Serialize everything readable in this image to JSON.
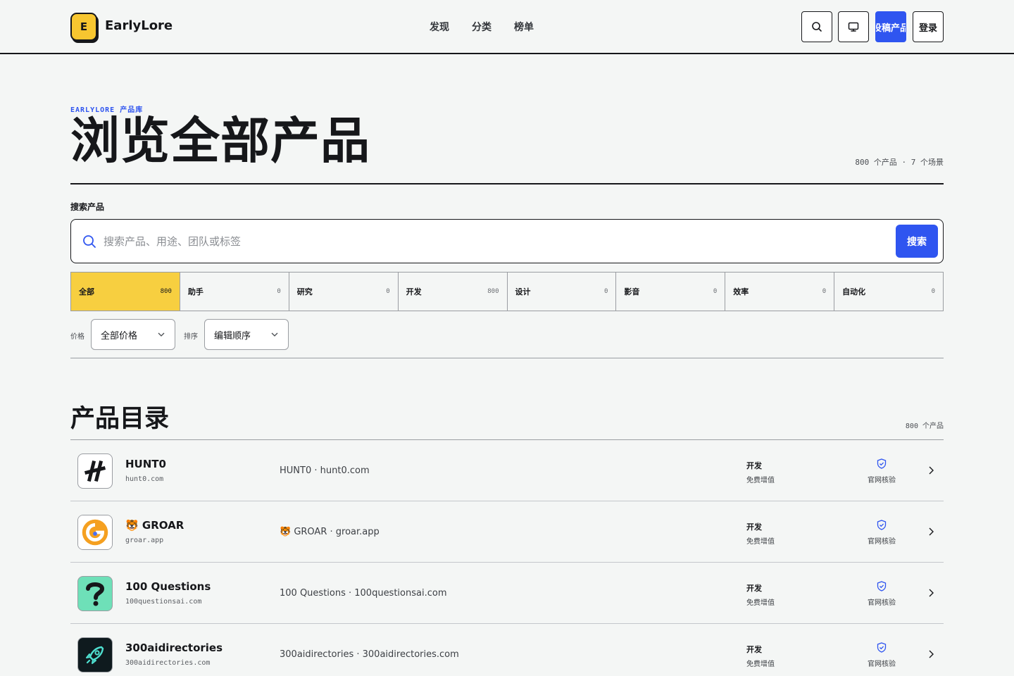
{
  "header": {
    "logo_letter": "E",
    "logo_text": "EarlyLore",
    "nav": [
      "发现",
      "分类",
      "榜单"
    ],
    "submit_label": "投稿产品",
    "login_label": "登录"
  },
  "hero": {
    "eyebrow": "EARLYLORE 产品库",
    "title": "浏览全部产品",
    "meta": "800 个产品 · 7 个场景"
  },
  "search": {
    "label": "搜索产品",
    "placeholder": "搜索产品、用途、团队或标签",
    "value": "",
    "button_label": "搜索"
  },
  "tabs": [
    {
      "label": "全部",
      "count": "800",
      "active": true
    },
    {
      "label": "助手",
      "count": "0",
      "active": false
    },
    {
      "label": "研究",
      "count": "0",
      "active": false
    },
    {
      "label": "开发",
      "count": "800",
      "active": false
    },
    {
      "label": "设计",
      "count": "0",
      "active": false
    },
    {
      "label": "影音",
      "count": "0",
      "active": false
    },
    {
      "label": "效率",
      "count": "0",
      "active": false
    },
    {
      "label": "自动化",
      "count": "0",
      "active": false
    }
  ],
  "filters": {
    "price_label": "价格",
    "price_value": "全部价格",
    "sort_label": "排序",
    "sort_value": "编辑顺序"
  },
  "catalog": {
    "title": "产品目录",
    "meta": "800 个产品",
    "items": [
      {
        "name": "HUNT0",
        "domain": "hunt0.com",
        "desc": "HUNT0 · hunt0.com",
        "category": "开发",
        "price": "免费增值",
        "verify": "官网核验",
        "icon": "hunt0-logo"
      },
      {
        "name": "🐯 GROAR",
        "domain": "groar.app",
        "desc": "🐯 GROAR · groar.app",
        "category": "开发",
        "price": "免费增值",
        "verify": "官网核验",
        "icon": "groar-logo"
      },
      {
        "name": "100 Questions",
        "domain": "100questionsai.com",
        "desc": "100 Questions · 100questionsai.com",
        "category": "开发",
        "price": "免费增值",
        "verify": "官网核验",
        "icon": "question-logo"
      },
      {
        "name": "300aidirectories",
        "domain": "300aidirectories.com",
        "desc": "300aidirectories · 300aidirectories.com",
        "category": "开发",
        "price": "免费增值",
        "verify": "官网核验",
        "icon": "rocket-logo"
      }
    ]
  },
  "colors": {
    "accent_blue": "#2f55f0",
    "accent_yellow": "#f7cf40",
    "ink": "#16171a",
    "background": "#f4f6f5"
  }
}
